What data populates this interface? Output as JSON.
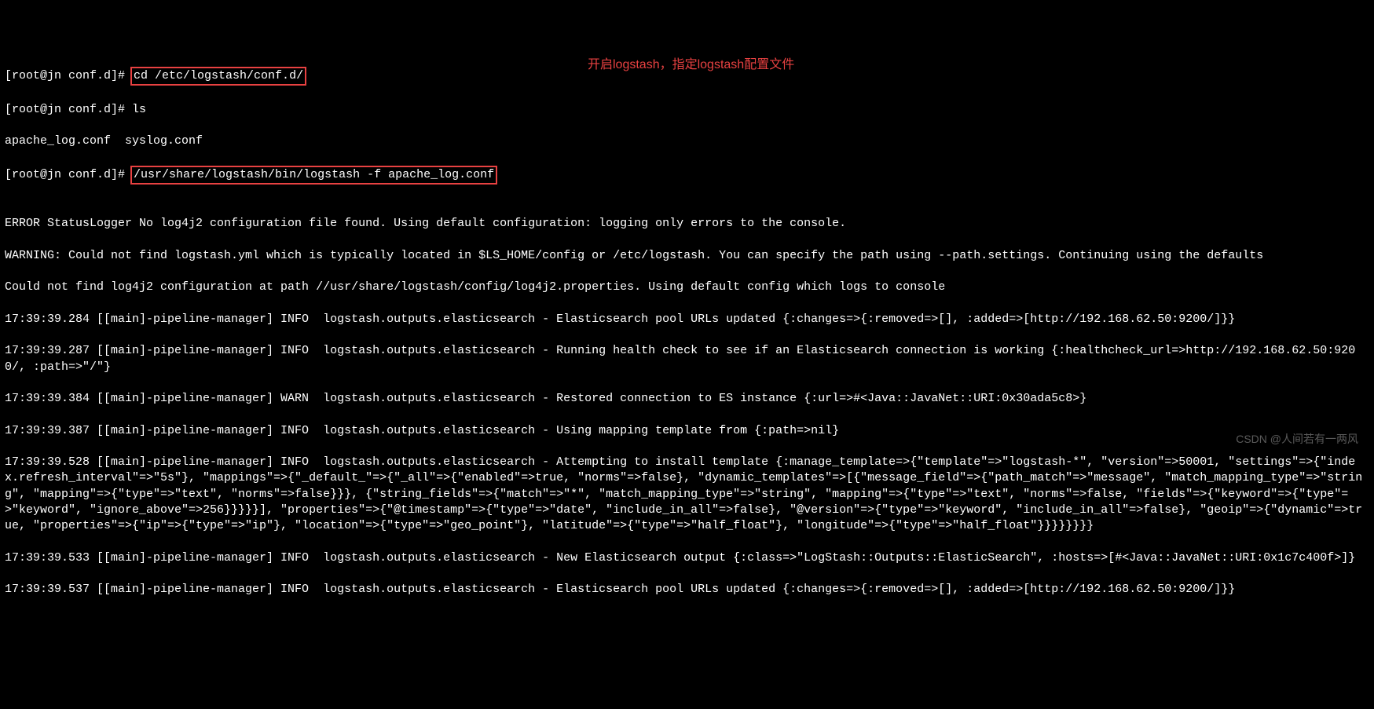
{
  "prompts": {
    "p1": "[root@jn conf.d]# ",
    "p2": "[root@jn conf.d]# ",
    "p3": "[root@jn conf.d]# "
  },
  "commands": {
    "cd": "cd /etc/logstash/conf.d/",
    "ls": "ls",
    "ls_output": "apache_log.conf  syslog.conf",
    "logstash_run": "/usr/share/logstash/bin/logstash -f apache_log.conf"
  },
  "annotation": {
    "text": "开启logstash，指定logstash配置文件"
  },
  "output": {
    "line_error": "ERROR StatusLogger No log4j2 configuration file found. Using default configuration: logging only errors to the console.",
    "line_warning": "WARNING: Could not find logstash.yml which is typically located in $LS_HOME/config or /etc/logstash. You can specify the path using --path.settings. Continuing using the defaults",
    "line_log4j2": "Could not find log4j2 configuration at path //usr/share/logstash/config/log4j2.properties. Using default config which logs to console",
    "line_284": "17:39:39.284 [[main]-pipeline-manager] INFO  logstash.outputs.elasticsearch - Elasticsearch pool URLs updated {:changes=>{:removed=>[], :added=>[http://192.168.62.50:9200/]}}",
    "line_287": "17:39:39.287 [[main]-pipeline-manager] INFO  logstash.outputs.elasticsearch - Running health check to see if an Elasticsearch connection is working {:healthcheck_url=>http://192.168.62.50:9200/, :path=>\"/\"}",
    "line_384": "17:39:39.384 [[main]-pipeline-manager] WARN  logstash.outputs.elasticsearch - Restored connection to ES instance {:url=>#<Java::JavaNet::URI:0x30ada5c8>}",
    "line_387": "17:39:39.387 [[main]-pipeline-manager] INFO  logstash.outputs.elasticsearch - Using mapping template from {:path=>nil}",
    "line_528": "17:39:39.528 [[main]-pipeline-manager] INFO  logstash.outputs.elasticsearch - Attempting to install template {:manage_template=>{\"template\"=>\"logstash-*\", \"version\"=>50001, \"settings\"=>{\"index.refresh_interval\"=>\"5s\"}, \"mappings\"=>{\"_default_\"=>{\"_all\"=>{\"enabled\"=>true, \"norms\"=>false}, \"dynamic_templates\"=>[{\"message_field\"=>{\"path_match\"=>\"message\", \"match_mapping_type\"=>\"string\", \"mapping\"=>{\"type\"=>\"text\", \"norms\"=>false}}}, {\"string_fields\"=>{\"match\"=>\"*\", \"match_mapping_type\"=>\"string\", \"mapping\"=>{\"type\"=>\"text\", \"norms\"=>false, \"fields\"=>{\"keyword\"=>{\"type\"=>\"keyword\", \"ignore_above\"=>256}}}}}], \"properties\"=>{\"@timestamp\"=>{\"type\"=>\"date\", \"include_in_all\"=>false}, \"@version\"=>{\"type\"=>\"keyword\", \"include_in_all\"=>false}, \"geoip\"=>{\"dynamic\"=>true, \"properties\"=>{\"ip\"=>{\"type\"=>\"ip\"}, \"location\"=>{\"type\"=>\"geo_point\"}, \"latitude\"=>{\"type\"=>\"half_float\"}, \"longitude\"=>{\"type\"=>\"half_float\"}}}}}}}}",
    "line_533": "17:39:39.533 [[main]-pipeline-manager] INFO  logstash.outputs.elasticsearch - New Elasticsearch output {:class=>\"LogStash::Outputs::ElasticSearch\", :hosts=>[#<Java::JavaNet::URI:0x1c7c400f>]}",
    "line_537": "17:39:39.537 [[main]-pipeline-manager] INFO  logstash.outputs.elasticsearch - Elasticsearch pool URLs updated {:changes=>{:removed=>[], :added=>[http://192.168.62.50:9200/]}}"
  },
  "watermark": "CSDN @人间若有一两风"
}
